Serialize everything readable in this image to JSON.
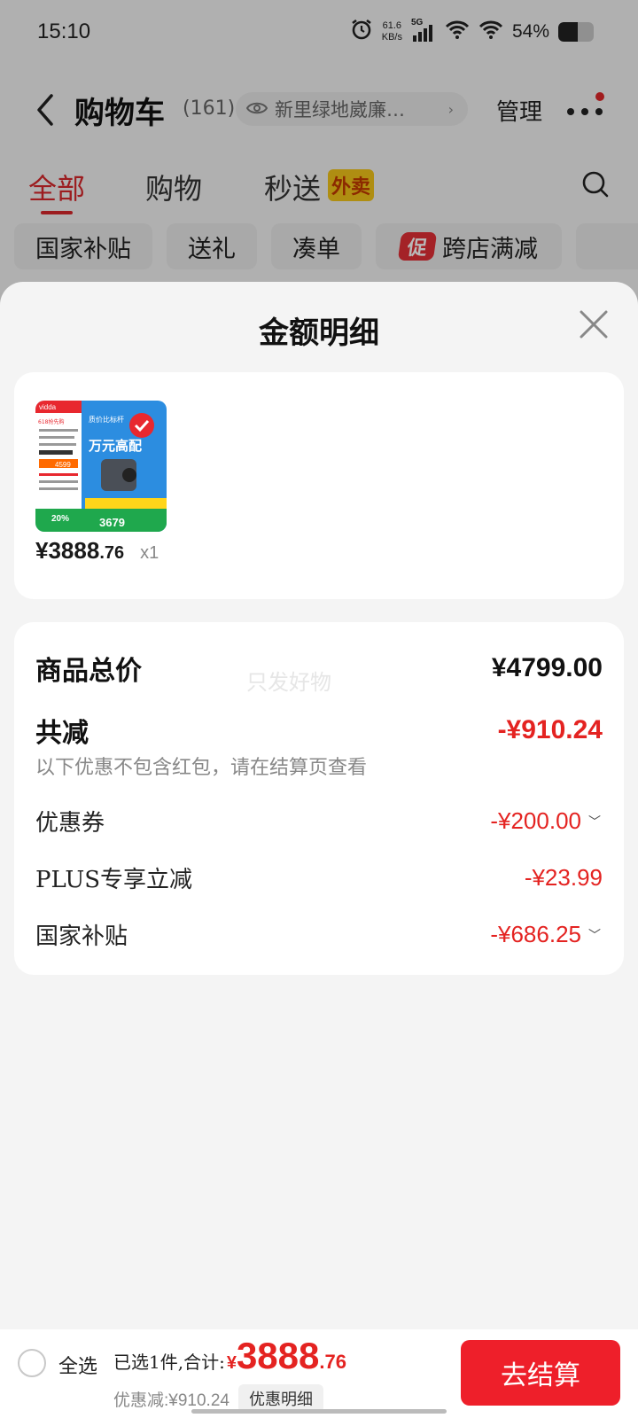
{
  "status_bar": {
    "time": "15:10",
    "speed_value": "61.6",
    "speed_unit": "KB/s",
    "network": "5G",
    "battery": "54%",
    "battery_level": 0.54
  },
  "nav": {
    "title": "购物车",
    "count": "(161)",
    "address": "新里绿地崴廉…",
    "manage": "管理"
  },
  "tabs": [
    {
      "label": "全部",
      "active": true
    },
    {
      "label": "购物",
      "active": false
    },
    {
      "label": "秒送",
      "tag": "外卖",
      "active": false
    }
  ],
  "chips": [
    {
      "label": "国家补贴"
    },
    {
      "label": "送礼"
    },
    {
      "label": "凑单"
    },
    {
      "label": "跨店满减",
      "badge": "促"
    }
  ],
  "sheet": {
    "title": "金额明细",
    "product": {
      "yuan": "¥",
      "price_int": "3888",
      "price_dec": ".76",
      "quantity": "x1",
      "thumb": {
        "brand": "vidda",
        "promo_top": "618抢先购",
        "headline": "万元高配",
        "subhead": "质价比标杆",
        "tag_left": "4599",
        "price": "3679",
        "discount": "20%"
      }
    },
    "breakdown": {
      "watermark": "只发好物",
      "total_label": "商品总价",
      "total_value": "¥4799.00",
      "reduce_label": "共减",
      "reduce_value": "-¥910.24",
      "note": "以下优惠不包含红包，请在结算页查看",
      "items": [
        {
          "label": "优惠券",
          "value": "-¥200.00",
          "expandable": true
        },
        {
          "label": "PLUS专享立减",
          "value": "-¥23.99",
          "expandable": false
        },
        {
          "label": "国家补贴",
          "value": "-¥686.25",
          "expandable": true
        }
      ]
    }
  },
  "bottom_bar": {
    "select_all": "全选",
    "selected_text": "已选1件,合计:",
    "currency": "¥",
    "total_int": "3888",
    "total_dec": ".76",
    "savings": "优惠减:¥910.24",
    "detail_button": "优惠明细",
    "checkout": "去结算"
  },
  "colors": {
    "accent_red": "#e42321",
    "checkout_red": "#ee1f2a",
    "tag_yellow": "#f3c51a"
  }
}
